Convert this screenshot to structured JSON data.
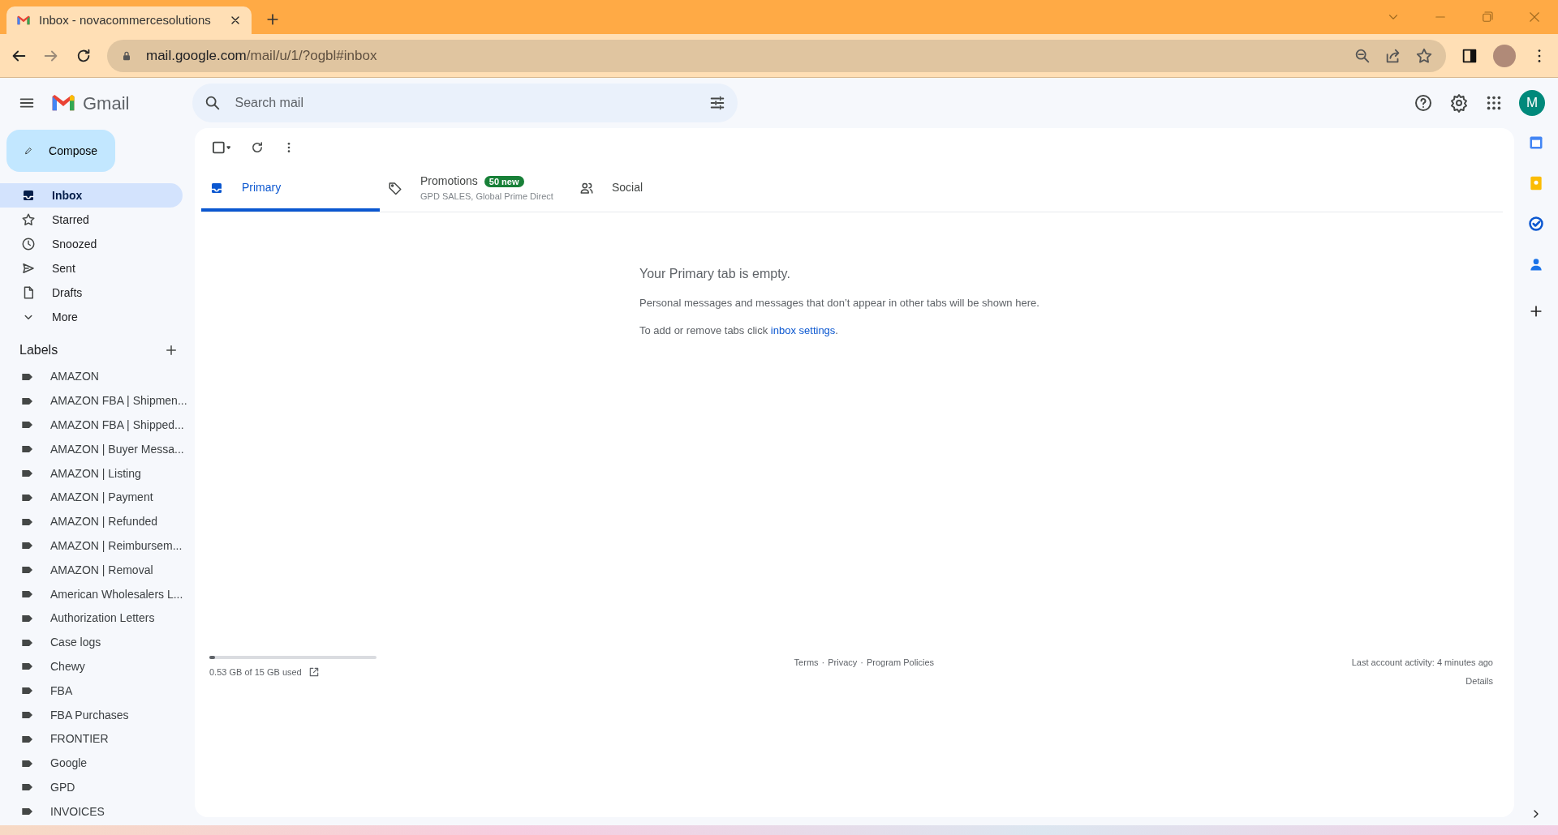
{
  "browser": {
    "tab_title": "Inbox - novacommercesolutions",
    "url_host": "mail.google.com",
    "url_path": "/mail/u/1/?ogbl#inbox"
  },
  "app": {
    "name": "Gmail",
    "search": {
      "placeholder": "Search mail"
    },
    "avatar_initial": "M"
  },
  "sidebar": {
    "compose": "Compose",
    "items": [
      {
        "label": "Inbox",
        "kind": "inbox",
        "selected": true
      },
      {
        "label": "Starred",
        "kind": "star",
        "selected": false
      },
      {
        "label": "Snoozed",
        "kind": "clock",
        "selected": false
      },
      {
        "label": "Sent",
        "kind": "send",
        "selected": false
      },
      {
        "label": "Drafts",
        "kind": "file",
        "selected": false
      },
      {
        "label": "More",
        "kind": "chevron",
        "selected": false
      }
    ],
    "labels_heading": "Labels",
    "labels": [
      "AMAZON",
      "AMAZON FBA | Shipmen...",
      "AMAZON FBA | Shipped...",
      "AMAZON | Buyer Messa...",
      "AMAZON | Listing",
      "AMAZON | Payment",
      "AMAZON | Refunded",
      "AMAZON | Reimbursem...",
      "AMAZON | Removal",
      "American Wholesalers L...",
      "Authorization Letters",
      "Case logs",
      "Chewy",
      "FBA",
      "FBA Purchases",
      "FRONTIER",
      "Google",
      "GPD",
      "INVOICES"
    ]
  },
  "tabs": [
    {
      "label": "Primary",
      "kind": "inbox",
      "selected": true
    },
    {
      "label": "Promotions",
      "kind": "tag",
      "selected": false,
      "badge": "50 new",
      "subtitle": "GPD SALES, Global Prime Direct"
    },
    {
      "label": "Social",
      "kind": "people",
      "selected": false
    }
  ],
  "empty_state": {
    "title": "Your Primary tab is empty.",
    "message": "Personal messages and messages that don’t appear in other tabs will be shown here.",
    "hint": "To add or remove tabs click ",
    "hint_link": "inbox settings",
    "hint_end": "."
  },
  "footer": {
    "storage": {
      "level": 0.035,
      "text": "0.53 GB of 15 GB used"
    },
    "links": [
      "Terms",
      "Privacy",
      "Program Policies"
    ],
    "separator": "·",
    "activity": "Last account activity: 4 minutes ago",
    "details": "Details"
  }
}
